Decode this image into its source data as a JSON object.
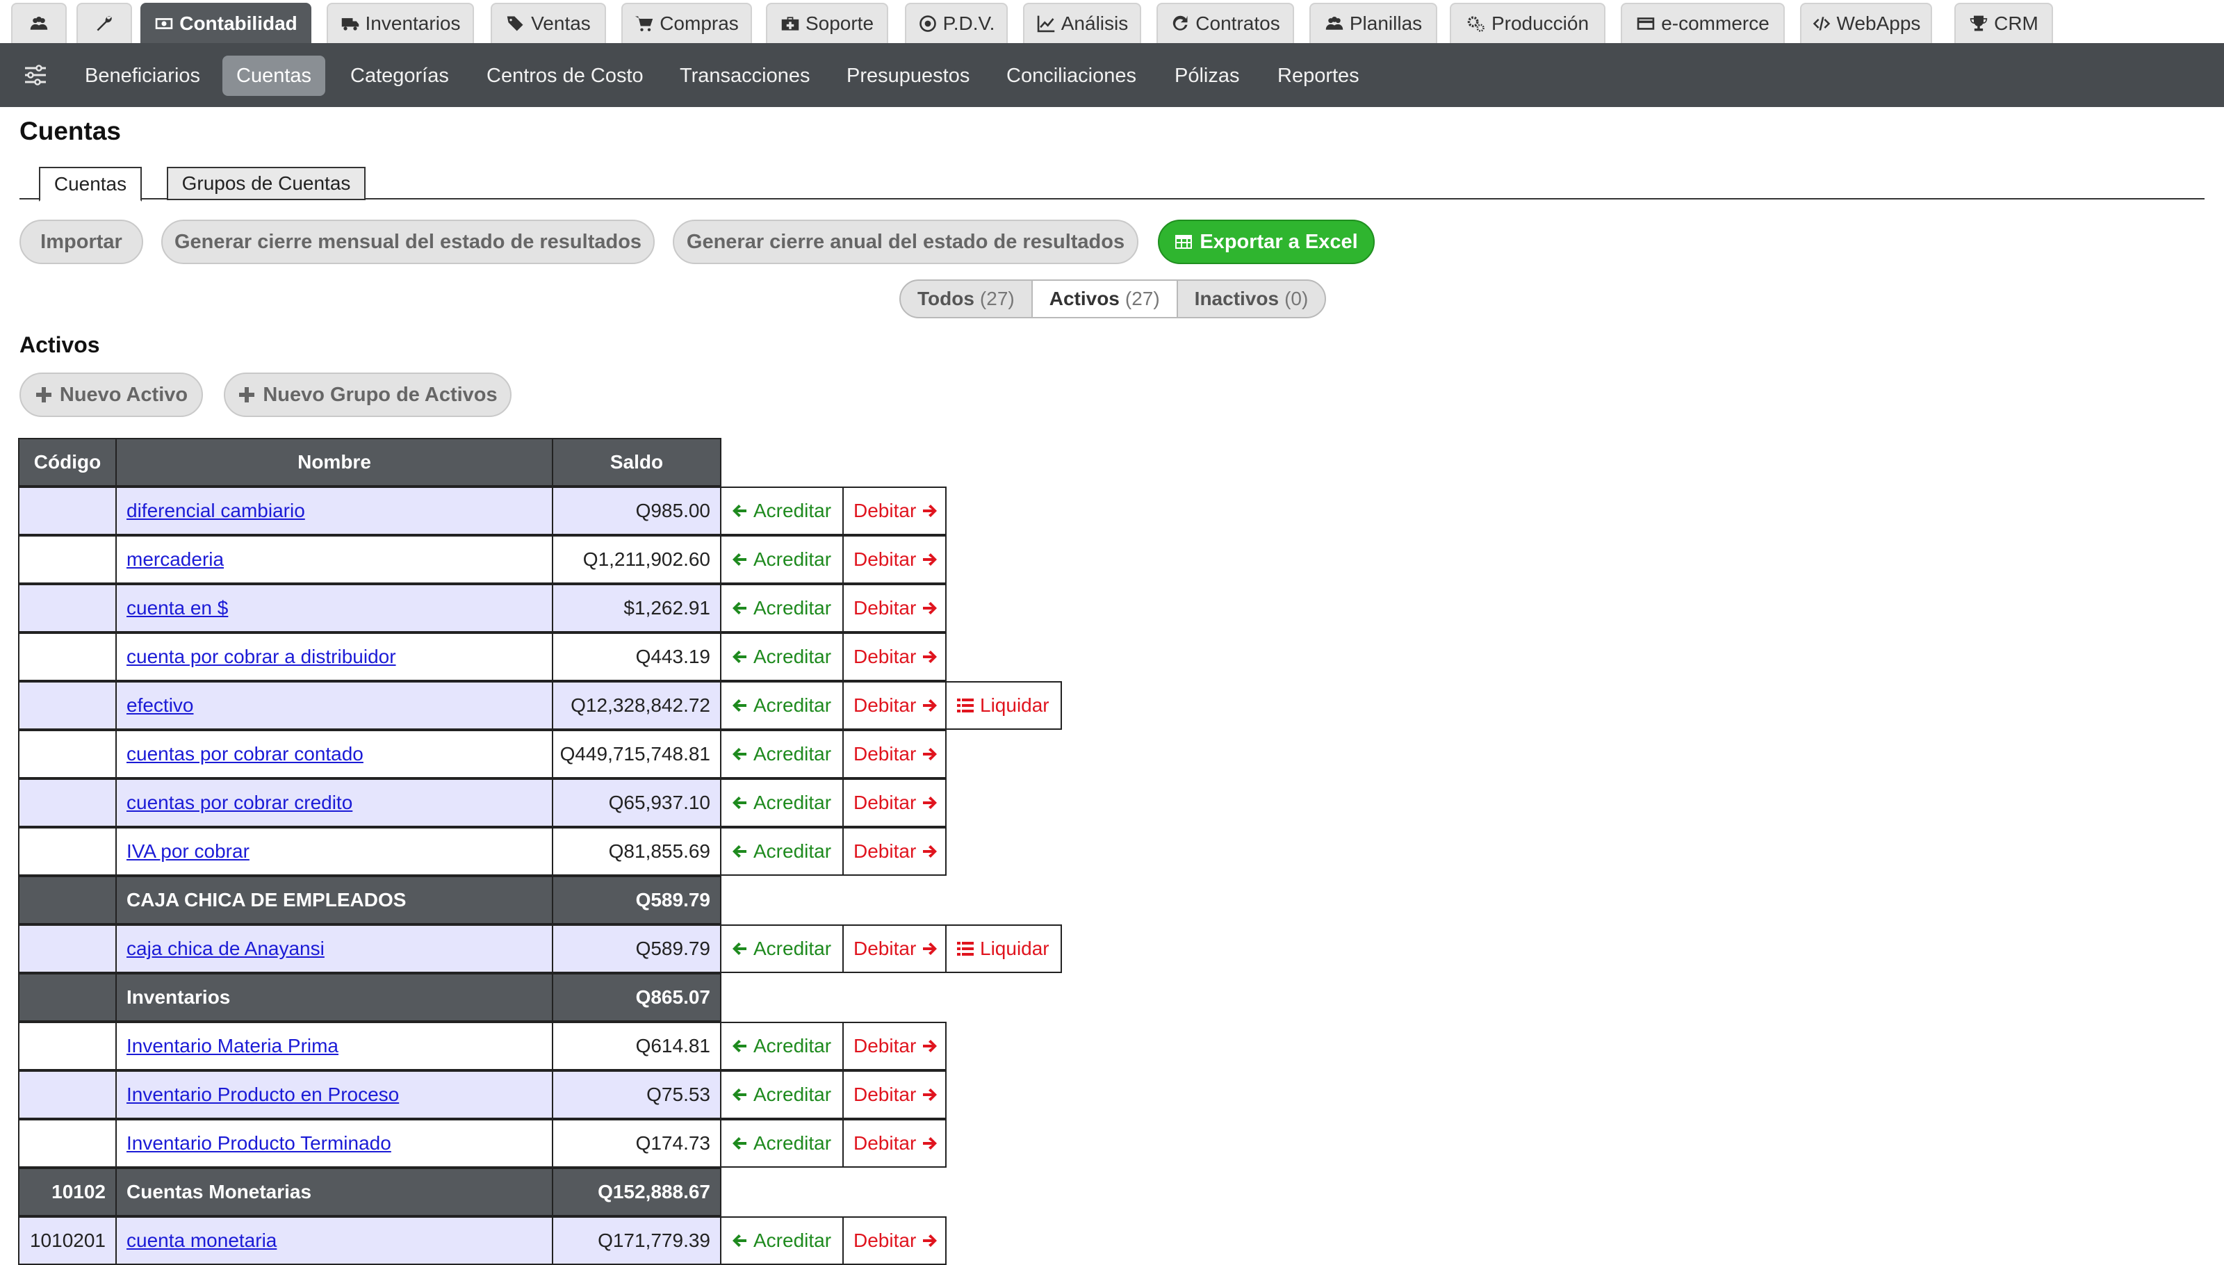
{
  "top_tabs": [
    {
      "label": "",
      "icon": "users-icon"
    },
    {
      "label": "",
      "icon": "wrench-icon"
    },
    {
      "label": "Contabilidad",
      "icon": "money-icon",
      "active": true
    },
    {
      "label": "Inventarios",
      "icon": "truck-icon"
    },
    {
      "label": "Ventas",
      "icon": "tags-icon"
    },
    {
      "label": "Compras",
      "icon": "cart-icon"
    },
    {
      "label": "Soporte",
      "icon": "medkit-icon"
    },
    {
      "label": "P.D.V.",
      "icon": "dot-circle-icon"
    },
    {
      "label": "Análisis",
      "icon": "line-chart-icon"
    },
    {
      "label": "Contratos",
      "icon": "refresh-icon"
    },
    {
      "label": "Planillas",
      "icon": "users-icon"
    },
    {
      "label": "Producción",
      "icon": "cogs-icon"
    },
    {
      "label": "e-commerce",
      "icon": "credit-card-icon"
    },
    {
      "label": "WebApps",
      "icon": "code-icon"
    },
    {
      "label": "CRM",
      "icon": "trophy-icon"
    }
  ],
  "subnav": {
    "menu_icon": "sliders-icon",
    "items": [
      {
        "label": "Beneficiarios"
      },
      {
        "label": "Cuentas",
        "active": true
      },
      {
        "label": "Categorías"
      },
      {
        "label": "Centros de Costo"
      },
      {
        "label": "Transacciones"
      },
      {
        "label": "Presupuestos"
      },
      {
        "label": "Conciliaciones"
      },
      {
        "label": "Pólizas"
      },
      {
        "label": "Reportes"
      }
    ]
  },
  "page": {
    "title": "Cuentas",
    "tabs": [
      "Cuentas",
      "Grupos de Cuentas"
    ]
  },
  "actions": {
    "importar": "Importar",
    "cierre_mensual": "Generar cierre mensual del estado de resultados",
    "cierre_anual": "Generar cierre anual del estado de resultados",
    "exportar": "Exportar a Excel"
  },
  "filters": [
    {
      "label": "Todos",
      "count": "(27)"
    },
    {
      "label": "Activos",
      "count": "(27)",
      "active": true
    },
    {
      "label": "Inactivos",
      "count": "(0)"
    }
  ],
  "section": {
    "title": "Activos",
    "nuevo_activo": "Nuevo Activo",
    "nuevo_grupo": "Nuevo Grupo de Activos"
  },
  "table": {
    "headers": {
      "codigo": "Código",
      "nombre": "Nombre",
      "saldo": "Saldo"
    },
    "action_labels": {
      "acreditar": "Acreditar",
      "debitar": "Debitar",
      "liquidar": "Liquidar"
    },
    "rows": [
      {
        "type": "account",
        "code": "",
        "name": "diferencial cambiario",
        "balance": "Q985.00"
      },
      {
        "type": "account",
        "code": "",
        "name": "mercaderia",
        "balance": "Q1,211,902.60"
      },
      {
        "type": "account",
        "code": "",
        "name": "cuenta en $",
        "balance": "$1,262.91"
      },
      {
        "type": "account",
        "code": "",
        "name": "cuenta por cobrar a distribuidor",
        "balance": "Q443.19"
      },
      {
        "type": "account",
        "code": "",
        "name": "efectivo",
        "balance": "Q12,328,842.72",
        "liquidar": true
      },
      {
        "type": "account",
        "code": "",
        "name": "cuentas por cobrar contado",
        "balance": "Q449,715,748.81"
      },
      {
        "type": "account",
        "code": "",
        "name": "cuentas por cobrar credito",
        "balance": "Q65,937.10"
      },
      {
        "type": "account",
        "code": "",
        "name": "IVA por cobrar",
        "balance": "Q81,855.69"
      },
      {
        "type": "group",
        "code": "",
        "name": "CAJA CHICA DE EMPLEADOS",
        "balance": "Q589.79"
      },
      {
        "type": "account",
        "code": "",
        "name": "caja chica de Anayansi",
        "balance": "Q589.79",
        "liquidar": true
      },
      {
        "type": "group",
        "code": "",
        "name": "Inventarios",
        "balance": "Q865.07"
      },
      {
        "type": "account",
        "code": "",
        "name": "Inventario Materia Prima",
        "balance": "Q614.81"
      },
      {
        "type": "account",
        "code": "",
        "name": "Inventario Producto en Proceso",
        "balance": "Q75.53"
      },
      {
        "type": "account",
        "code": "",
        "name": "Inventario Producto Terminado",
        "balance": "Q174.73"
      },
      {
        "type": "group",
        "code": "10102",
        "name": "Cuentas Monetarias",
        "balance": "Q152,888.67"
      },
      {
        "type": "account",
        "code": "1010201",
        "name": "cuenta monetaria",
        "balance": "Q171,779.39"
      }
    ]
  },
  "colors": {
    "accent_green": "#2fb52f",
    "credit_green": "#1e8a1e",
    "debit_red": "#e0141e",
    "link_blue": "#1b1bd6",
    "dark_bar": "#474b4f",
    "row_stripe": "#e5e5fd"
  }
}
